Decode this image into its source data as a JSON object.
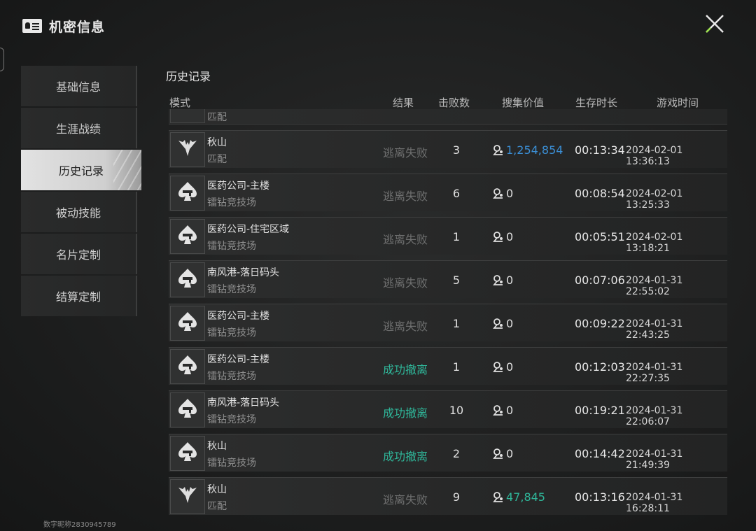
{
  "app": {
    "title": "机密信息",
    "user_id": "数字昵称2830945789"
  },
  "sidebar": {
    "items": [
      {
        "label": "基础信息",
        "active": false
      },
      {
        "label": "生涯战绩",
        "active": false
      },
      {
        "label": "历史记录",
        "active": true
      },
      {
        "label": "被动技能",
        "active": false
      },
      {
        "label": "名片定制",
        "active": false
      },
      {
        "label": "结算定制",
        "active": false
      }
    ]
  },
  "history": {
    "title": "历史记录",
    "columns": {
      "mode": "模式",
      "result": "结果",
      "kills": "击败数",
      "value": "搜集价值",
      "duration": "生存时长",
      "time": "游戏时间"
    },
    "partial_row": {
      "mode": "匹配"
    },
    "rows": [
      {
        "map": "秋山",
        "mode": "匹配",
        "icon": "wings-icon",
        "result": "逃离失败",
        "success": false,
        "kills": "3",
        "value": "1,254,854",
        "value_color": "blue",
        "duration": "00:13:34",
        "time": "2024-02-01 13:36:13"
      },
      {
        "map": "医药公司-主楼",
        "mode": "镭钻竞技场",
        "icon": "spade-gun-icon",
        "result": "逃离失败",
        "success": false,
        "kills": "6",
        "value": "0",
        "value_color": "white",
        "duration": "00:08:54",
        "time": "2024-02-01 13:25:33"
      },
      {
        "map": "医药公司-住宅区域",
        "mode": "镭钻竞技场",
        "icon": "spade-gun-icon",
        "result": "逃离失败",
        "success": false,
        "kills": "1",
        "value": "0",
        "value_color": "white",
        "duration": "00:05:51",
        "time": "2024-02-01 13:18:21"
      },
      {
        "map": "南风港-落日码头",
        "mode": "镭钻竞技场",
        "icon": "spade-gun-icon",
        "result": "逃离失败",
        "success": false,
        "kills": "5",
        "value": "0",
        "value_color": "white",
        "duration": "00:07:06",
        "time": "2024-01-31 22:55:02"
      },
      {
        "map": "医药公司-主楼",
        "mode": "镭钻竞技场",
        "icon": "spade-gun-icon",
        "result": "逃离失败",
        "success": false,
        "kills": "1",
        "value": "0",
        "value_color": "white",
        "duration": "00:09:22",
        "time": "2024-01-31 22:43:25"
      },
      {
        "map": "医药公司-主楼",
        "mode": "镭钻竞技场",
        "icon": "spade-gun-icon",
        "result": "成功撤离",
        "success": true,
        "kills": "1",
        "value": "0",
        "value_color": "white",
        "duration": "00:12:03",
        "time": "2024-01-31 22:27:35"
      },
      {
        "map": "南风港-落日码头",
        "mode": "镭钻竞技场",
        "icon": "spade-gun-icon",
        "result": "成功撤离",
        "success": true,
        "kills": "10",
        "value": "0",
        "value_color": "white",
        "duration": "00:19:21",
        "time": "2024-01-31 22:06:07"
      },
      {
        "map": "秋山",
        "mode": "镭钻竞技场",
        "icon": "spade-gun-icon",
        "result": "成功撤离",
        "success": true,
        "kills": "2",
        "value": "0",
        "value_color": "white",
        "duration": "00:14:42",
        "time": "2024-01-31 21:49:39"
      },
      {
        "map": "秋山",
        "mode": "匹配",
        "icon": "wings-icon",
        "result": "逃离失败",
        "success": false,
        "kills": "9",
        "value": "47,845",
        "value_color": "green",
        "duration": "00:13:16",
        "time": "2024-01-31 16:28:11"
      }
    ]
  },
  "colors": {
    "success": "#2fb79a",
    "fail": "#6f7070",
    "value_blue": "#3b8fd6",
    "close_accent": "#9be24a"
  }
}
